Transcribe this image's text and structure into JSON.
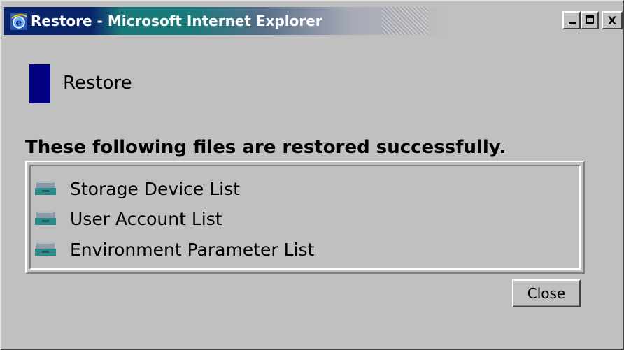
{
  "window": {
    "title": "Restore - Microsoft Internet Explorer",
    "icon": "ie-icon",
    "controls": {
      "minimize": "minimize-icon",
      "maximize": "maximize-icon",
      "close_glyph": "X"
    }
  },
  "page": {
    "heading": "Restore",
    "message": "These following files are restored successfully.",
    "files": [
      {
        "label": "Storage Device List",
        "icon": "file-drawer-icon"
      },
      {
        "label": "User Account List",
        "icon": "file-drawer-icon"
      },
      {
        "label": "Environment Parameter List",
        "icon": "file-drawer-icon"
      }
    ],
    "close_label": "Close"
  },
  "colors": {
    "heading_bar": "#000080",
    "title_start": "#0a246a",
    "title_accent": "#1a7a7a",
    "face": "#c0c0c0",
    "file_icon": "#2a8a8a"
  }
}
